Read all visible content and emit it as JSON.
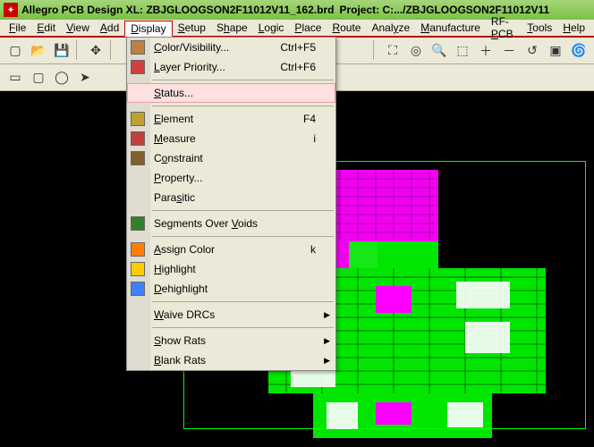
{
  "title": {
    "app": "Allegro PCB Design XL: ZBJGLOOGSON2F11012V11_162.brd",
    "project": "Project: C:.../ZBJGLOOGSON2F11012V11"
  },
  "menubar": [
    {
      "label": "File",
      "u": 0
    },
    {
      "label": "Edit",
      "u": 0
    },
    {
      "label": "View",
      "u": 0
    },
    {
      "label": "Add",
      "u": 0
    },
    {
      "label": "Display",
      "u": 0,
      "open": true
    },
    {
      "label": "Setup",
      "u": 0
    },
    {
      "label": "Shape",
      "u": 1
    },
    {
      "label": "Logic",
      "u": 0
    },
    {
      "label": "Place",
      "u": 0
    },
    {
      "label": "Route",
      "u": 0
    },
    {
      "label": "Analyze",
      "u": 4
    },
    {
      "label": "Manufacture",
      "u": 0
    },
    {
      "label": "RF-PCB",
      "u": 3
    },
    {
      "label": "Tools",
      "u": 0
    },
    {
      "label": "Help",
      "u": 0
    }
  ],
  "toolbar1": [
    "new-icon",
    "open-icon",
    "save-icon",
    "sep",
    "move-icon",
    "sep"
  ],
  "toolbar1b": [
    "sep",
    "zoom-all-icon",
    "zoom-center-icon",
    "zoom-window-icon",
    "zoom-fit-icon",
    "zoom-in-icon",
    "zoom-out-icon",
    "zoom-prev-icon",
    "zoom-sel-icon",
    "refresh-icon"
  ],
  "toolbar2": [
    "rect-icon",
    "roundrect-icon",
    "circle-icon",
    "select-icon"
  ],
  "dropdown": [
    {
      "label": "Color/Visibility...",
      "u": 0,
      "short": "Ctrl+F5",
      "icon": "palette-icon",
      "iconColor": "#c08040"
    },
    {
      "label": "Layer Priority...",
      "u": 0,
      "short": "Ctrl+F6",
      "icon": "layers-icon",
      "iconColor": "#d04040"
    },
    {
      "sep": true
    },
    {
      "label": "Status...",
      "u": 0,
      "hover": true
    },
    {
      "sep": true
    },
    {
      "label": "Element",
      "u": 0,
      "short": "F4",
      "icon": "element-icon",
      "iconColor": "#c0a030"
    },
    {
      "label": "Measure",
      "u": 0,
      "short": "i",
      "icon": "measure-icon",
      "iconColor": "#c04040"
    },
    {
      "label": "Constraint",
      "u": 1,
      "icon": "constraint-icon",
      "iconColor": "#806030"
    },
    {
      "label": "Property...",
      "u": 0
    },
    {
      "label": "Parasitic",
      "u": 4
    },
    {
      "sep": true
    },
    {
      "label": "Segments Over Voids",
      "u": 14,
      "icon": "segments-icon",
      "iconColor": "#308030"
    },
    {
      "sep": true
    },
    {
      "label": "Assign Color",
      "u": 0,
      "short": "k",
      "icon": "assign-color-icon",
      "iconColor": "#ff8000"
    },
    {
      "label": "Highlight",
      "u": 0,
      "icon": "highlight-icon",
      "iconColor": "#ffcc00"
    },
    {
      "label": "Dehighlight",
      "u": 0,
      "icon": "dehighlight-icon",
      "iconColor": "#4080ff"
    },
    {
      "sep": true
    },
    {
      "label": "Waive DRCs",
      "u": 0,
      "sub": true
    },
    {
      "sep": true
    },
    {
      "label": "Show Rats",
      "u": 0,
      "sub": true
    },
    {
      "label": "Blank Rats",
      "u": 0,
      "sub": true
    }
  ],
  "colors": {
    "titlebar": "#7bc143",
    "menuHighlight": "#ffe0e0",
    "pcbGreen": "#00ff00",
    "pcbMagenta": "#ff00ff",
    "pcbWhite": "#ffffff"
  }
}
